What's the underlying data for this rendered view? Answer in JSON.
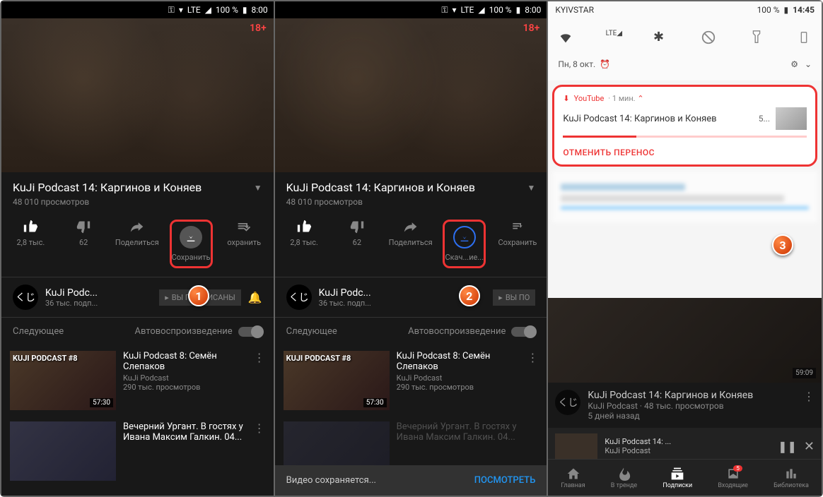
{
  "status": {
    "battery": "100 %",
    "time": "8:00",
    "lte": "LTE"
  },
  "age": "18+",
  "video": {
    "title": "KuJi Podcast 14: Каргинов и Коняев",
    "views": "48 010 просмотров"
  },
  "actions": {
    "like": "2,8 тыс.",
    "dislike": "62",
    "share": "Поделиться",
    "download": "Сохранить",
    "downloading": "Скач...ие...",
    "save": "охранить",
    "save2": "Сохранить"
  },
  "channel": {
    "logo": "くじ",
    "name": "KuJi Podc...",
    "subs": "36 тыс. подп...",
    "button": "ВЫ ПОДПИСАНЫ",
    "button2": "ВЫ ПО"
  },
  "next": {
    "label": "Следующее",
    "autoplay": "Автовоспроизведение"
  },
  "items": [
    {
      "overlay": "KUJI PODCAST #8",
      "title": "KuJi Podcast 8: Семён Слепаков",
      "channel": "KuJi Podcast",
      "views": "290 тыс. просмотров",
      "dur": "57:30"
    },
    {
      "overlay": "",
      "title": "Вечерний Ургант. В гостях у Ивана Максим Галкин. 04...",
      "channel": "",
      "views": "",
      "dur": ""
    }
  ],
  "snackbar": {
    "text": "Видео сохраняется...",
    "action": "ПОСМОТРЕТЬ"
  },
  "p3": {
    "carrier": "KYIVSTAR",
    "battery": "100 %",
    "time": "14:45",
    "date": "Пн, 8 окт.",
    "notif": {
      "app": "YouTube",
      "time": "1 мин.",
      "title": "KuJi Podcast 14: Каргинов и Коняев",
      "pct": "5...",
      "cancel": "ОТМЕНИТЬ ПЕРЕНОС"
    },
    "bg": {
      "dur": "59:09",
      "title": "KuJi Podcast 14: Каргинов и Коняев",
      "meta": "KuJi Podcast · 48 тыс. просмотров",
      "age": "5 дней назад"
    },
    "mini": {
      "title": "KuJi Podcast 14: ...",
      "sub": "KuJi Podcast"
    },
    "nav": {
      "home": "Главная",
      "trending": "В тренде",
      "subs": "Подписки",
      "inbox": "Входящие",
      "lib": "Библиотека",
      "badge": "5"
    }
  }
}
